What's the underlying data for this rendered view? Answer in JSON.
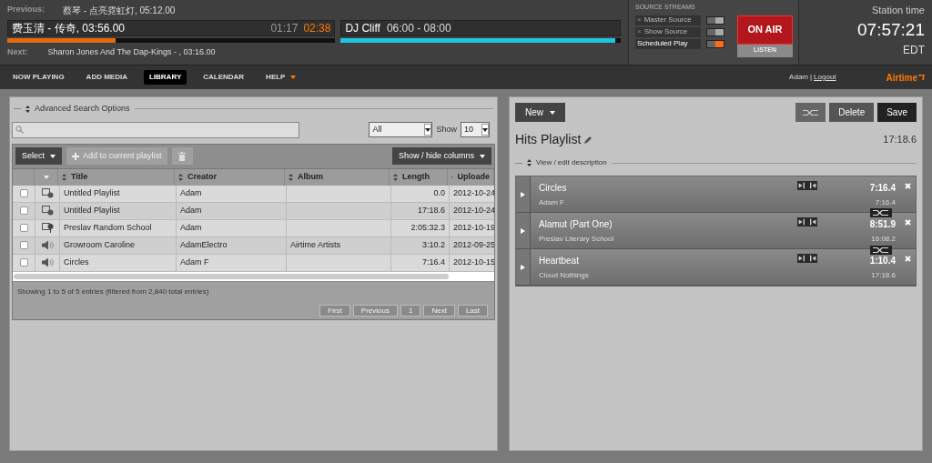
{
  "now_playing": {
    "previous_label": "Previous:",
    "previous": "蔡琴 - 点亮霓虹灯, 05:12.00",
    "current": "费玉清 - 传奇, 03:56.00",
    "elapsed": "01:17",
    "remaining": "02:38",
    "level": 0.33,
    "next_label": "Next:",
    "next": "Sharon Jones And The Dap-Kings - , 03:16.00"
  },
  "show": {
    "name": "DJ Cliff",
    "time": "06:00 - 08:00",
    "level": 0.98
  },
  "source_streams": {
    "title": "SOURCE STREAMS",
    "sources": [
      {
        "label": "Master Source",
        "close": "×",
        "on": false
      },
      {
        "label": "Show Source",
        "close": "×",
        "on": false
      },
      {
        "label": "Scheduled Play",
        "on": true
      }
    ],
    "on_air": "ON AIR",
    "listen": "LISTEN"
  },
  "station_time": {
    "label": "Station time",
    "time": "07:57:21",
    "zone": "EDT"
  },
  "nav": [
    {
      "label": "NOW PLAYING",
      "selected": false
    },
    {
      "label": "ADD MEDIA",
      "selected": false
    },
    {
      "label": "LIBRARY",
      "selected": true
    },
    {
      "label": "CALENDAR",
      "selected": false
    },
    {
      "label": "HELP",
      "selected": false,
      "dropdown": true
    }
  ],
  "user": {
    "name": "Adam",
    "separator": "|",
    "logout": "Logout",
    "brand": "Airtime"
  },
  "library": {
    "advanced_search": "Advanced Search Options",
    "type_filter": "All",
    "show_label": "Show",
    "show_value": "10",
    "toolbar": {
      "select": "Select",
      "add": "Add to current playlist",
      "columns": "Show / hide columns"
    },
    "columns": [
      "Title",
      "Creator",
      "Album",
      "Length",
      "Uploade"
    ],
    "rows": [
      {
        "kind": "playlist",
        "checked": false,
        "cells": [
          "Untitled Playlist",
          "Adam",
          "",
          "0.0",
          "2012-10-24"
        ]
      },
      {
        "kind": "playlist",
        "checked": false,
        "cells": [
          "Untitled Playlist",
          "Adam",
          "",
          "17:18.6",
          "2012-10-24"
        ]
      },
      {
        "kind": "smart-block",
        "checked": false,
        "cells": [
          "Preslav Random School",
          "Adam",
          "",
          "2:05:32.3",
          "2012-10-19"
        ]
      },
      {
        "kind": "audio",
        "checked": false,
        "cells": [
          "Growroom Caroline",
          "AdamElectro",
          "Airtime Artists",
          "3:10.2",
          "2012-09-25"
        ]
      },
      {
        "kind": "audio",
        "checked": false,
        "cells": [
          "Circles",
          "Adam F",
          "",
          "7:16.4",
          "2012-10-15"
        ]
      }
    ],
    "info": "Showing 1 to 5 of 5 entries (filtered from 2,840 total entries)",
    "pager": [
      "First",
      "Previous",
      "1",
      "Next",
      "Last"
    ]
  },
  "playlist": {
    "new": "New",
    "delete": "Delete",
    "save": "Save",
    "title": "Hits Playlist",
    "length": "17:18.6",
    "description": "View / edit description",
    "items": [
      {
        "title": "Circles",
        "artist": "Adam F",
        "length": "7:16.4",
        "cumulative": "7:16.4"
      },
      {
        "title": "Alamut (Part One)",
        "artist": "Preslav Literary School",
        "length": "8:51.9",
        "cumulative": "16:08.2"
      },
      {
        "title": "Heartbeat",
        "artist": "Cloud Nothings",
        "length": "1:10.4",
        "cumulative": "17:18.6"
      }
    ]
  }
}
